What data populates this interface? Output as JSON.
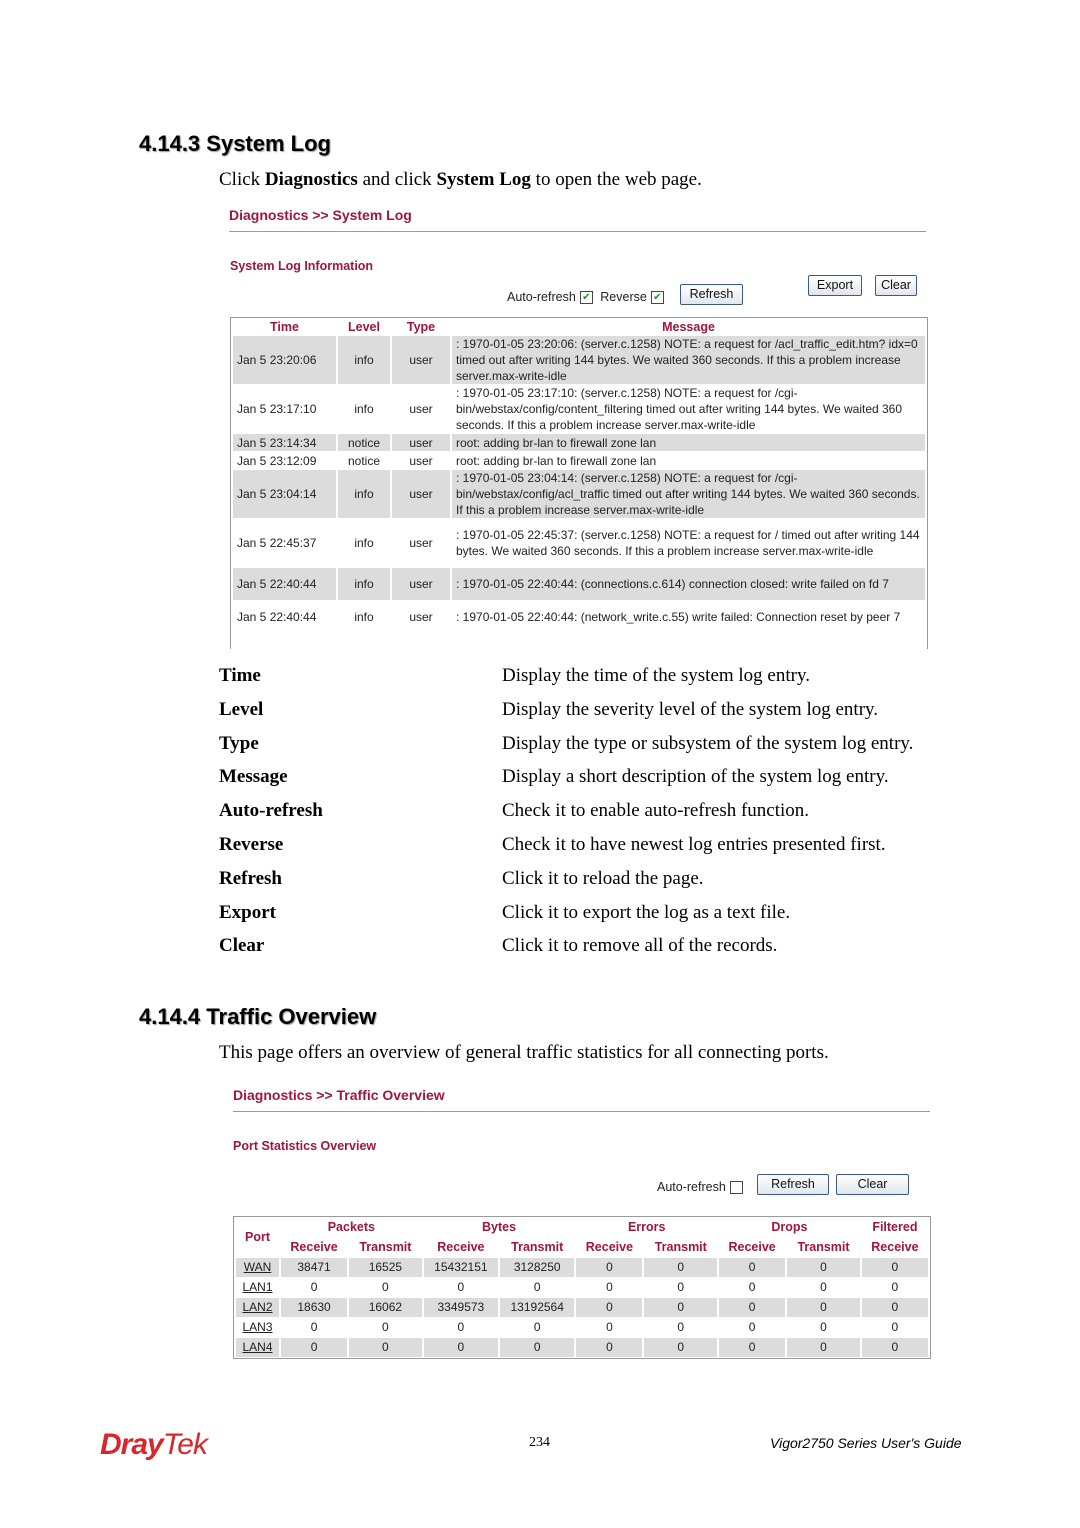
{
  "section1": {
    "heading": "4.14.3 System Log",
    "intro": [
      "Click ",
      "Diagnostics",
      " and click ",
      "System Log",
      " to open the web page."
    ],
    "breadcrumb": "Diagnostics >> System Log",
    "subtitle": "System Log Information",
    "auto_refresh_label": "Auto-refresh",
    "auto_refresh_checked": true,
    "reverse_label": "Reverse",
    "reverse_checked": true,
    "refresh_button": "Refresh",
    "export_button": "Export",
    "clear_button": "Clear",
    "columns": [
      "Time",
      "Level",
      "Type",
      "Message"
    ],
    "rows": [
      [
        "Jan  5 23:20:06",
        "info",
        "user",
        ": 1970-01-05 23:20:06: (server.c.1258) NOTE: a request for /acl_traffic_edit.htm? idx=0 timed out after writing 144 bytes. We waited 360 seconds. If this a problem increase server.max-write-idle"
      ],
      [
        "Jan  5 23:17:10",
        "info",
        "user",
        ": 1970-01-05 23:17:10: (server.c.1258) NOTE: a request for /cgi-bin/webstax/config/content_filtering timed out after writing 144 bytes. We waited 360 seconds. If this a problem increase server.max-write-idle"
      ],
      [
        "Jan  5 23:14:34",
        "notice",
        "user",
        "root: adding br-lan to firewall zone lan"
      ],
      [
        "Jan  5 23:12:09",
        "notice",
        "user",
        "root: adding br-lan to firewall zone lan"
      ],
      [
        "Jan  5 23:04:14",
        "info",
        "user",
        ": 1970-01-05 23:04:14: (server.c.1258) NOTE: a request for /cgi-bin/webstax/config/acl_traffic timed out after writing 144 bytes. We waited 360 seconds. If this a problem increase server.max-write-idle"
      ],
      [
        "Jan  5 22:45:37",
        "info",
        "user",
        ": 1970-01-05 22:45:37: (server.c.1258) NOTE: a request for / timed out after writing 144 bytes. We waited 360 seconds. If this a problem increase server.max-write-idle"
      ],
      [
        "Jan  5 22:40:44",
        "info",
        "user",
        ": 1970-01-05 22:40:44: (connections.c.614) connection closed: write failed on fd 7"
      ],
      [
        "Jan  5 22:40:44",
        "info",
        "user",
        ": 1970-01-05 22:40:44: (network_write.c.55) write failed:  Connection reset by peer 7"
      ]
    ],
    "definitions": [
      {
        "term": "Time",
        "desc": "Display the time of the system log entry."
      },
      {
        "term": "Level",
        "desc": "Display the severity level of the system log entry."
      },
      {
        "term": "Type",
        "desc": "Display the type or subsystem of the system log entry."
      },
      {
        "term": "Message",
        "desc": "Display a short description of the system log entry."
      },
      {
        "term": "Auto-refresh",
        "desc": "Check it to enable auto-refresh function."
      },
      {
        "term": "Reverse",
        "desc": "Check it to have newest log entries presented first."
      },
      {
        "term": "Refresh",
        "desc": "Click it to reload the page."
      },
      {
        "term": "Export",
        "desc": "Click it to export the log as a text file."
      },
      {
        "term": "Clear",
        "desc": "Click it to remove all of the records."
      }
    ]
  },
  "section2": {
    "heading": "4.14.4 Traffic Overview",
    "intro": "This page offers an overview of general traffic statistics for all connecting ports.",
    "breadcrumb": "Diagnostics >> Traffic Overview",
    "subtitle": "Port Statistics Overview",
    "auto_refresh_label": "Auto-refresh",
    "auto_refresh_checked": false,
    "refresh_button": "Refresh",
    "clear_button": "Clear",
    "port_header": "Port",
    "groups": [
      "Packets",
      "Bytes",
      "Errors",
      "Drops",
      "Filtered"
    ],
    "subheaders": [
      "Receive",
      "Transmit",
      "Receive",
      "Transmit",
      "Receive",
      "Transmit",
      "Receive",
      "Transmit",
      "Receive"
    ],
    "rows": [
      [
        "WAN",
        "38471",
        "16525",
        "15432151",
        "3128250",
        "0",
        "0",
        "0",
        "0",
        "0"
      ],
      [
        "LAN1",
        "0",
        "0",
        "0",
        "0",
        "0",
        "0",
        "0",
        "0",
        "0"
      ],
      [
        "LAN2",
        "18630",
        "16062",
        "3349573",
        "13192564",
        "0",
        "0",
        "0",
        "0",
        "0"
      ],
      [
        "LAN3",
        "0",
        "0",
        "0",
        "0",
        "0",
        "0",
        "0",
        "0",
        "0"
      ],
      [
        "LAN4",
        "0",
        "0",
        "0",
        "0",
        "0",
        "0",
        "0",
        "0",
        "0"
      ]
    ]
  },
  "footer": {
    "logo": "DrayTek",
    "page_number": "234",
    "guide_title": "Vigor2750  Series  User's  Guide"
  },
  "colors": {
    "accent": "#a0163c",
    "row_gray": "#dcdcdc",
    "logo_red": "#d9262c"
  }
}
